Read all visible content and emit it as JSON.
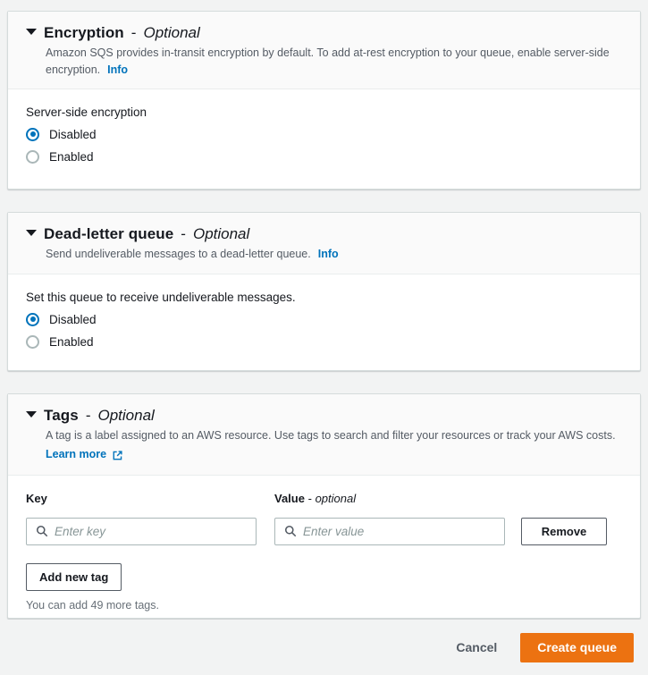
{
  "colors": {
    "accent_blue": "#0073bb",
    "action_orange": "#ec7211",
    "page_bg": "#f2f3f3",
    "card_bg": "#ffffff",
    "border": "#d5dbdb",
    "text": "#16191f",
    "muted_text": "#545b64"
  },
  "sections": {
    "encryption": {
      "title": "Encryption",
      "dash": "-",
      "optional": "Optional",
      "description": "Amazon SQS provides in-transit encryption by default. To add at-rest encryption to your queue, enable server-side encryption.",
      "info_label": "Info",
      "caret_icon": "caret-down-icon",
      "field_label": "Server-side encryption",
      "options": [
        {
          "label": "Disabled",
          "selected": true
        },
        {
          "label": "Enabled",
          "selected": false
        }
      ]
    },
    "dead_letter_queue": {
      "title": "Dead-letter queue",
      "dash": "-",
      "optional": "Optional",
      "description": "Send undeliverable messages to a dead-letter queue.",
      "info_label": "Info",
      "caret_icon": "caret-down-icon",
      "field_label": "Set this queue to receive undeliverable messages.",
      "options": [
        {
          "label": "Disabled",
          "selected": true
        },
        {
          "label": "Enabled",
          "selected": false
        }
      ]
    },
    "tags": {
      "title": "Tags",
      "dash": "-",
      "optional": "Optional",
      "description": "A tag is a label assigned to an AWS resource. Use tags to search and filter your resources or track your AWS costs.",
      "learn_more_label": "Learn more",
      "learn_more_icon": "external-link-icon",
      "caret_icon": "caret-down-icon",
      "key_label": "Key",
      "value_label": "Value",
      "value_dash": "-",
      "value_optional": "optional",
      "key_placeholder": "Enter key",
      "key_value": "",
      "value_placeholder": "Enter value",
      "value_value": "",
      "search_icon": "search-icon",
      "remove_label": "Remove",
      "add_tag_label": "Add new tag",
      "remaining_hint": "You can add 49 more tags."
    }
  },
  "footer": {
    "cancel_label": "Cancel",
    "create_label": "Create queue"
  }
}
